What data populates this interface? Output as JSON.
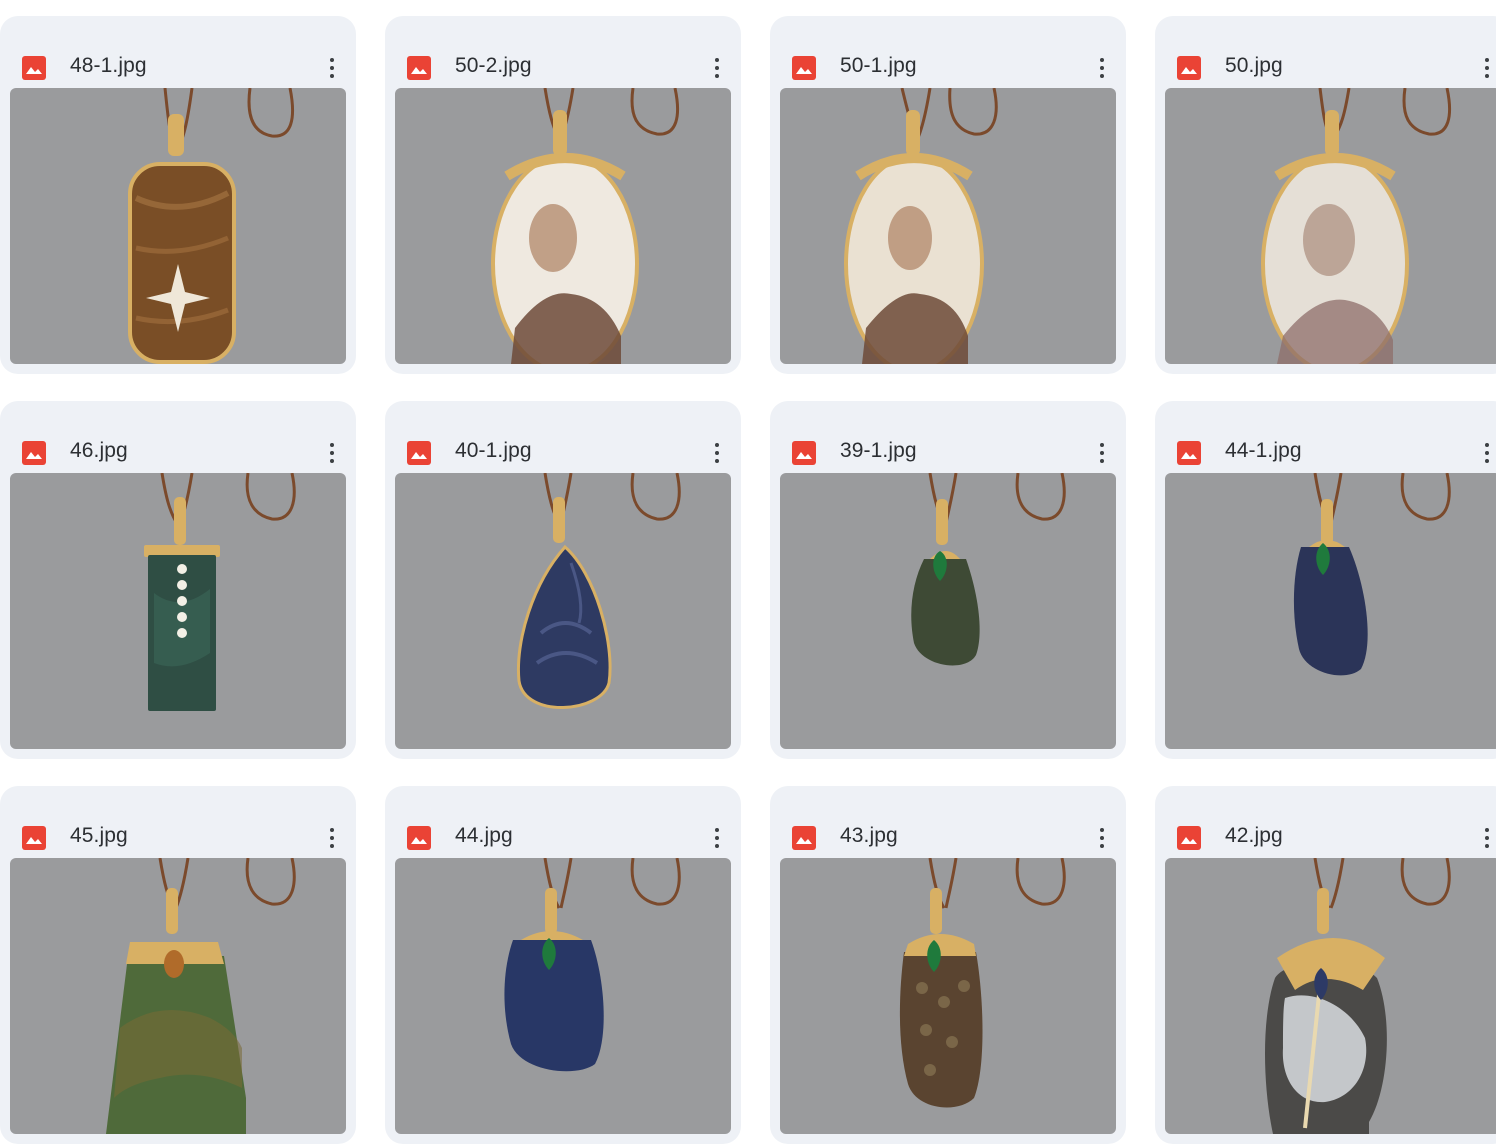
{
  "files": [
    {
      "name": "48-1.jpg",
      "pendant": "tiger-eye-moon-star",
      "icon": "image-file-icon",
      "menu_icon": "more-vertical-icon"
    },
    {
      "name": "50-2.jpg",
      "pendant": "cameo-shell-crown",
      "icon": "image-file-icon",
      "menu_icon": "more-vertical-icon"
    },
    {
      "name": "50-1.jpg",
      "pendant": "cameo-shell-crown",
      "icon": "image-file-icon",
      "menu_icon": "more-vertical-icon"
    },
    {
      "name": "50.jpg",
      "pendant": "cameo-shell-pink",
      "icon": "image-file-icon",
      "menu_icon": "more-vertical-icon"
    },
    {
      "name": "46.jpg",
      "pendant": "green-bar-diamonds",
      "icon": "image-file-icon",
      "menu_icon": "more-vertical-icon"
    },
    {
      "name": "40-1.jpg",
      "pendant": "carved-sapphire-teardrop",
      "icon": "image-file-icon",
      "menu_icon": "more-vertical-icon"
    },
    {
      "name": "39-1.jpg",
      "pendant": "small-green-stone-emerald",
      "icon": "image-file-icon",
      "menu_icon": "more-vertical-icon"
    },
    {
      "name": "44-1.jpg",
      "pendant": "sapphire-slab-emerald",
      "icon": "image-file-icon",
      "menu_icon": "more-vertical-icon"
    },
    {
      "name": "45.jpg",
      "pendant": "green-slab-citrine-cap",
      "icon": "image-file-icon",
      "menu_icon": "more-vertical-icon"
    },
    {
      "name": "44.jpg",
      "pendant": "sapphire-slab-emerald-cap",
      "icon": "image-file-icon",
      "menu_icon": "more-vertical-icon"
    },
    {
      "name": "43.jpg",
      "pendant": "fossil-coral-emerald-cap",
      "icon": "image-file-icon",
      "menu_icon": "more-vertical-icon"
    },
    {
      "name": "42.jpg",
      "pendant": "agate-feather-diamond-umbrella",
      "icon": "image-file-icon",
      "menu_icon": "more-vertical-icon"
    }
  ],
  "colors": {
    "card_background": "#eef1f6",
    "photo_background": "#9a9b9d",
    "file_icon": "#ea4335",
    "filename_text": "#2c2f33",
    "cord": "#7b4a2c",
    "gold": "#d8b064"
  }
}
